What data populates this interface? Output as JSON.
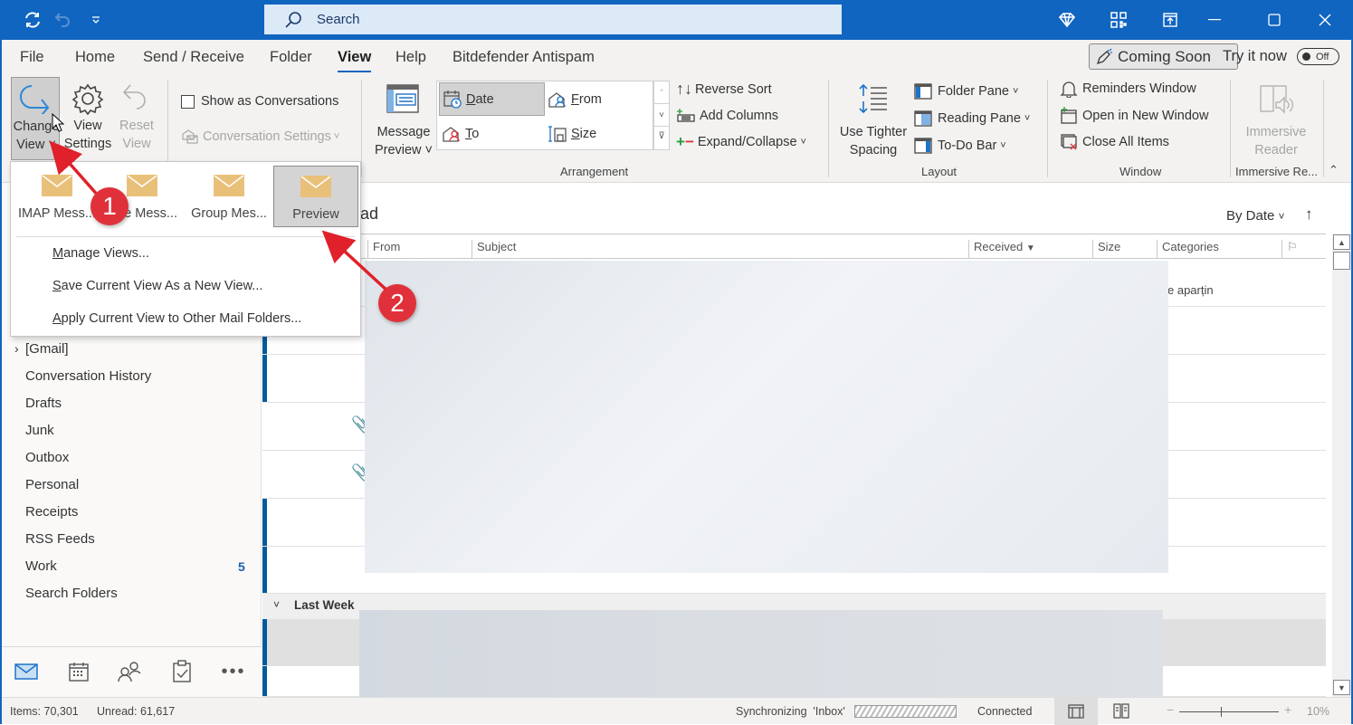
{
  "titlebar": {
    "search_placeholder": "Search"
  },
  "menu": {
    "tabs": [
      "File",
      "Home",
      "Send / Receive",
      "Folder",
      "View",
      "Help",
      "Bitdefender Antispam"
    ],
    "active": "View",
    "coming_soon": "Coming Soon",
    "try_it_now": "Try it now",
    "toggle_state": "Off"
  },
  "ribbon": {
    "current_view": {
      "change_view": [
        "Change",
        "View"
      ],
      "view_settings": [
        "View",
        "Settings"
      ],
      "reset_view": [
        "Reset",
        "View"
      ]
    },
    "messages": {
      "show_as_conversations": "Show as Conversations",
      "show_as_conversations_checked": false,
      "conversation_settings": "Conversation Settings"
    },
    "arrangement": {
      "message_preview": [
        "Message",
        "Preview"
      ],
      "options": [
        {
          "label": "Date",
          "selected": true
        },
        {
          "label": "From",
          "selected": false
        },
        {
          "label": "To",
          "selected": false
        },
        {
          "label": "Size",
          "selected": false
        }
      ],
      "reverse_sort": "Reverse Sort",
      "add_columns": "Add Columns",
      "expand_collapse": "Expand/Collapse",
      "group_label": "Arrangement"
    },
    "layout": {
      "use_tighter_spacing": [
        "Use Tighter",
        "Spacing"
      ],
      "folder_pane": "Folder Pane",
      "reading_pane": "Reading Pane",
      "todo_bar": "To-Do Bar",
      "group_label": "Layout"
    },
    "window": {
      "reminders_window": "Reminders Window",
      "open_in_new_window": "Open in New Window",
      "close_all_items": "Close All Items",
      "group_label": "Window"
    },
    "immersive": {
      "immersive_reader": [
        "Immersive",
        "Reader"
      ],
      "group_label": "Immersive Re..."
    }
  },
  "change_view_menu": {
    "views": [
      {
        "label": "IMAP Mess...",
        "selected": false
      },
      {
        "label": "e Mess...",
        "selected": false
      },
      {
        "label": "Group Mes...",
        "selected": false
      },
      {
        "label": "Preview",
        "selected": true
      }
    ],
    "items": [
      {
        "label": "Manage Views...",
        "accel": "M"
      },
      {
        "label": "Save Current View As a New View...",
        "accel": "S"
      },
      {
        "label": "Apply Current View to Other Mail Folders...",
        "accel": "A"
      }
    ]
  },
  "callouts": [
    "1",
    "2"
  ],
  "folders": [
    {
      "label": "[Gmail]",
      "expandable": true
    },
    {
      "label": "Conversation History"
    },
    {
      "label": "Drafts"
    },
    {
      "label": "Junk"
    },
    {
      "label": "Outbox"
    },
    {
      "label": "Personal"
    },
    {
      "label": "Receipts"
    },
    {
      "label": "RSS Feeds"
    },
    {
      "label": "Work",
      "count": "5"
    },
    {
      "label": "Search Folders"
    }
  ],
  "nav_icons": [
    "mail-icon",
    "calendar-icon",
    "people-icon",
    "tasks-icon",
    "more-icon"
  ],
  "mail_list": {
    "title_partial": "ead",
    "sort_label": "By Date",
    "columns": [
      "From",
      "Subject",
      "Received",
      "Size",
      "Categories"
    ],
    "visible_snippet": "e aparțin",
    "group_header": "Last Week"
  },
  "status": {
    "items": "Items: 70,301",
    "unread": "Unread: 61,617",
    "sync": "Synchronizing  'Inbox'",
    "connection": "Connected",
    "zoom": "10%"
  }
}
